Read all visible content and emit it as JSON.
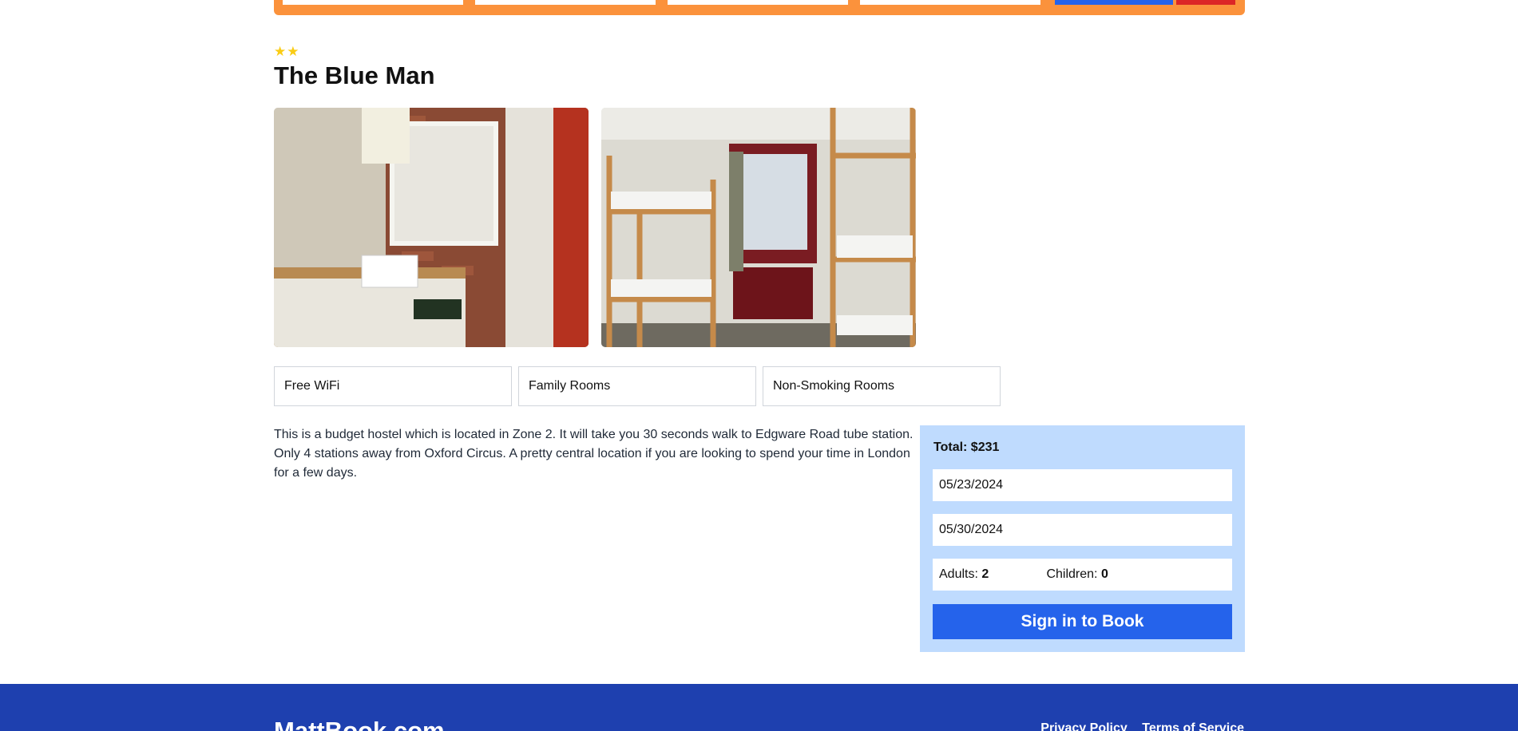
{
  "hotel": {
    "stars": "★★",
    "name": "The Blue Man",
    "facilities": [
      "Free WiFi",
      "Family Rooms",
      "Non-Smoking Rooms"
    ],
    "description": "This is a budget hostel which is located in Zone 2. It will take you 30 seconds walk to Edgware Road tube station. Only 4 stations away from Oxford Circus. A pretty central location if you are looking to spend your time in London for a few days."
  },
  "booking": {
    "total": "Total: $231",
    "check_in": "05/23/2024",
    "check_out": "05/30/2024",
    "adults_label": "Adults:",
    "adults_value": "2",
    "children_label": "Children:",
    "children_value": "0",
    "button_label": "Sign in to Book"
  },
  "footer": {
    "brand": "MattBook.com",
    "links": [
      "Privacy Policy",
      "Terms of Service"
    ]
  },
  "colors": {
    "search_bar": "#fb923c",
    "primary": "#2563eb",
    "footer": "#1e40af",
    "booking_panel": "#bfdbfe",
    "star": "#facc15"
  },
  "icons": {
    "rating": "star-icon"
  }
}
